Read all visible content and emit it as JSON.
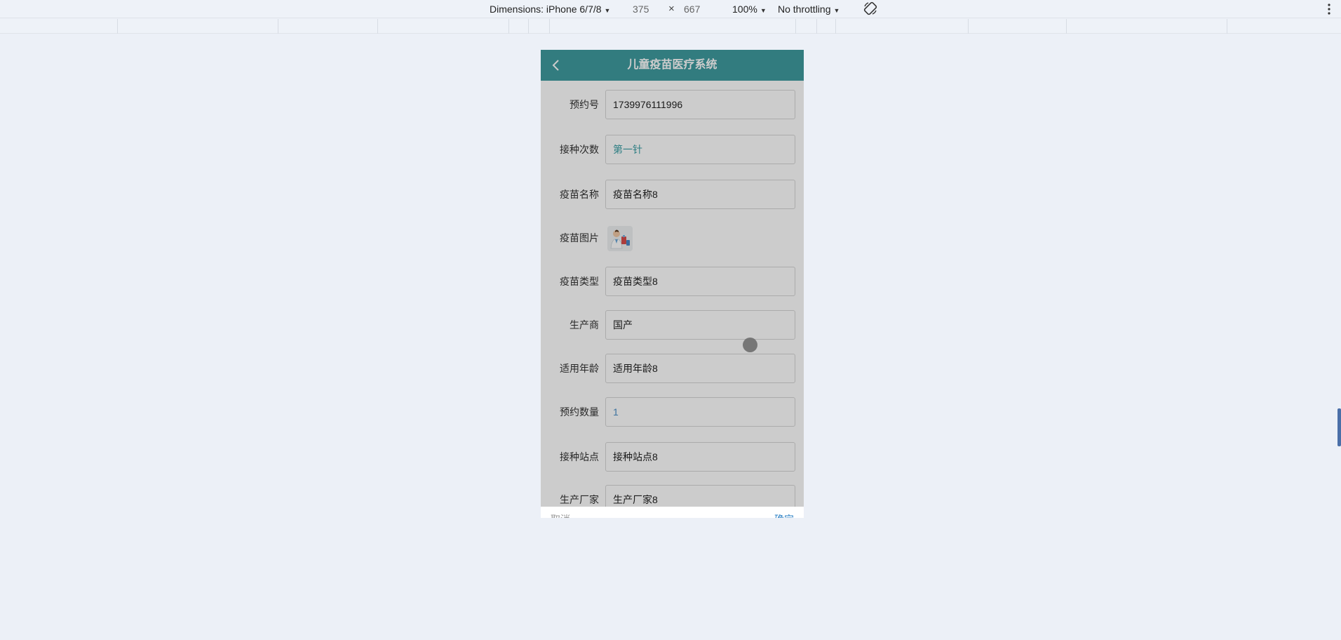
{
  "devtools": {
    "dimensions_label": "Dimensions: iPhone 6/7/8",
    "width": "375",
    "times": "×",
    "height": "667",
    "zoom": "100%",
    "throttling": "No throttling"
  },
  "app": {
    "title": "儿童疫苗医疗系统",
    "header_color": "#3f9b9f"
  },
  "form": {
    "fields": [
      {
        "label": "预约号",
        "value": "1739976111996"
      },
      {
        "label": "接种次数",
        "value": "第一针"
      },
      {
        "label": "疫苗名称",
        "value": "疫苗名称8"
      },
      {
        "label": "疫苗图片",
        "value": ""
      },
      {
        "label": "疫苗类型",
        "value": "疫苗类型8"
      },
      {
        "label": "生产商",
        "value": "国产"
      },
      {
        "label": "适用年龄",
        "value": "适用年龄8"
      },
      {
        "label": "预约数量",
        "value": "1"
      },
      {
        "label": "接种站点",
        "value": "接种站点8"
      },
      {
        "label": "生产厂家",
        "value": "生产厂家8"
      }
    ]
  },
  "footer": {
    "cancel_label": "取消",
    "confirm_label": "确定"
  }
}
